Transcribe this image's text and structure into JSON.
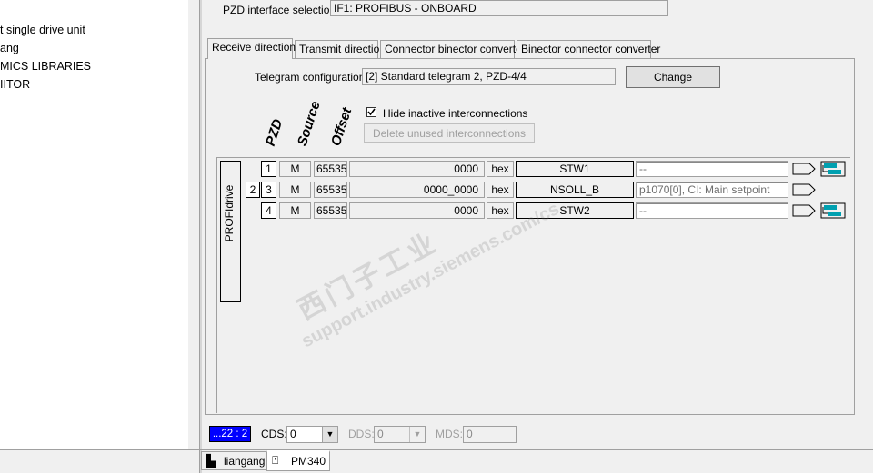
{
  "tree": {
    "items": [
      "t single drive unit",
      "ang",
      "MICS LIBRARIES",
      "IITOR"
    ]
  },
  "header": {
    "pzd_label": "PZD interface selection:",
    "pzd_value": "IF1:  PROFIBUS - ONBOARD"
  },
  "tabs": [
    {
      "label": "Receive direction"
    },
    {
      "label": "Transmit direction"
    },
    {
      "label": "Connector binector converter"
    },
    {
      "label": "Binector connector converter"
    }
  ],
  "telegram": {
    "label": "Telegram configuration:",
    "value": "[2] Standard telegram 2, PZD-4/4",
    "change_label": "Change"
  },
  "columns": {
    "pzd": "PZD",
    "source": "Source",
    "offset": "Offset"
  },
  "options": {
    "hide_inactive_label": "Hide inactive interconnections",
    "hide_inactive_checked": true,
    "delete_unused_label": "Delete unused interconnections"
  },
  "profidrive_label": "PROFIdrive",
  "rows": [
    {
      "pre": "",
      "pzd": "1",
      "source": "M",
      "offset": "65535",
      "value": "0000",
      "format": "hex",
      "signal": "STW1",
      "target": "--"
    },
    {
      "pre": "2",
      "pzd": "3",
      "source": "M",
      "offset": "65535",
      "value": "0000_0000",
      "format": "hex",
      "signal": "NSOLL_B",
      "target": "p1070[0], CI: Main setpoint"
    },
    {
      "pre": "",
      "pzd": "4",
      "source": "M",
      "offset": "65535",
      "value": "0000",
      "format": "hex",
      "signal": "STW2",
      "target": "--"
    }
  ],
  "watermark": {
    "line1": "西门子工业",
    "line2": "support.industry.siemens.com/cs"
  },
  "status": {
    "index": "...22 : 2",
    "cds_label": "CDS:",
    "cds_value": "0",
    "dds_label": "DDS:",
    "dds_value": "0",
    "mds_label": "MDS:",
    "mds_value": "0"
  },
  "bottom_tabs": [
    {
      "label": "liangang"
    },
    {
      "label": "PM340"
    }
  ],
  "colors": {
    "index_bg": "#0000ff",
    "connector_icon": "#00a0b0"
  }
}
